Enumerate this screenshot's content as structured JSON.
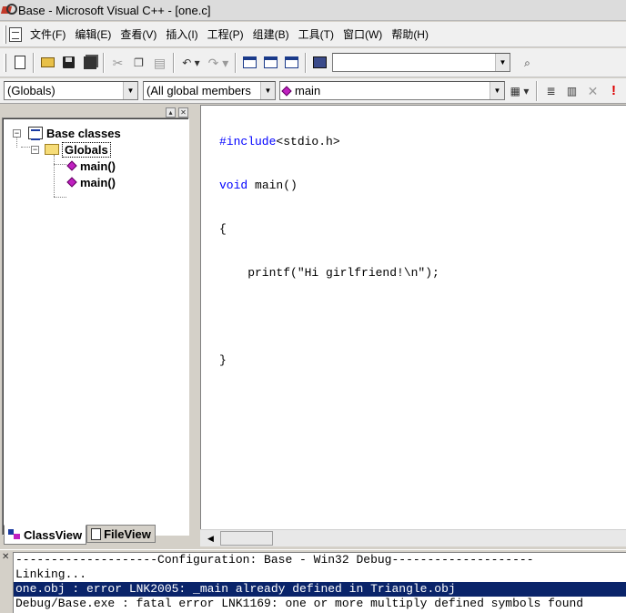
{
  "window": {
    "title": "Base - Microsoft Visual C++ - [one.c]"
  },
  "menu": [
    "文件(F)",
    "编辑(E)",
    "查看(V)",
    "插入(I)",
    "工程(P)",
    "组建(B)",
    "工具(T)",
    "窗口(W)",
    "帮助(H)"
  ],
  "toolbar": {
    "find_combo_value": "",
    "scope_combo": "(Globals)",
    "members_combo": "(All global members",
    "function_combo": "main"
  },
  "workspace": {
    "root": "Base classes",
    "folder": "Globals",
    "items": [
      "main()",
      "main()"
    ],
    "tabs": {
      "classview": "ClassView",
      "fileview": "FileView"
    }
  },
  "editor": {
    "filename": "one.c",
    "lines": [
      {
        "kw": "#include",
        "rest": "<stdio.h>"
      },
      {
        "kw": "void",
        "rest": " main()"
      },
      {
        "kw": "",
        "rest": "{"
      },
      {
        "kw": "",
        "rest": "    printf(\"Hi girlfriend!\\n\");"
      },
      {
        "kw": "",
        "rest": ""
      },
      {
        "kw": "",
        "rest": "}"
      }
    ]
  },
  "output": {
    "lines": [
      "--------------------Configuration: Base - Win32 Debug--------------------",
      "Linking...",
      "one.obj : error LNK2005: _main already defined in Triangle.obj",
      "Debug/Base.exe : fatal error LNK1169: one or more multiply defined symbols found"
    ],
    "highlighted_index": 2
  },
  "colors": {
    "keyword": "#0000ff",
    "selection": "#0a246a",
    "member_icon": "#c020c0"
  }
}
